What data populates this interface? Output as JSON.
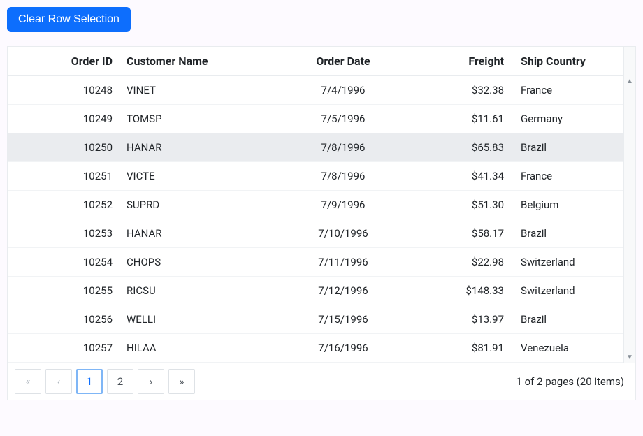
{
  "toolbar": {
    "clear_label": "Clear Row Selection"
  },
  "grid": {
    "columns": {
      "order_id": "Order ID",
      "customer_name": "Customer Name",
      "order_date": "Order Date",
      "freight": "Freight",
      "ship_country": "Ship Country"
    },
    "rows": [
      {
        "id": "10248",
        "name": "VINET",
        "date": "7/4/1996",
        "freight": "$32.38",
        "country": "France",
        "selected": false
      },
      {
        "id": "10249",
        "name": "TOMSP",
        "date": "7/5/1996",
        "freight": "$11.61",
        "country": "Germany",
        "selected": false
      },
      {
        "id": "10250",
        "name": "HANAR",
        "date": "7/8/1996",
        "freight": "$65.83",
        "country": "Brazil",
        "selected": true
      },
      {
        "id": "10251",
        "name": "VICTE",
        "date": "7/8/1996",
        "freight": "$41.34",
        "country": "France",
        "selected": false
      },
      {
        "id": "10252",
        "name": "SUPRD",
        "date": "7/9/1996",
        "freight": "$51.30",
        "country": "Belgium",
        "selected": false
      },
      {
        "id": "10253",
        "name": "HANAR",
        "date": "7/10/1996",
        "freight": "$58.17",
        "country": "Brazil",
        "selected": false
      },
      {
        "id": "10254",
        "name": "CHOPS",
        "date": "7/11/1996",
        "freight": "$22.98",
        "country": "Switzerland",
        "selected": false
      },
      {
        "id": "10255",
        "name": "RICSU",
        "date": "7/12/1996",
        "freight": "$148.33",
        "country": "Switzerland",
        "selected": false
      },
      {
        "id": "10256",
        "name": "WELLI",
        "date": "7/15/1996",
        "freight": "$13.97",
        "country": "Brazil",
        "selected": false
      },
      {
        "id": "10257",
        "name": "HILAA",
        "date": "7/16/1996",
        "freight": "$81.91",
        "country": "Venezuela",
        "selected": false
      }
    ]
  },
  "pager": {
    "first": "«",
    "prev": "‹",
    "pages": [
      "1",
      "2"
    ],
    "active_page": "1",
    "next": "›",
    "last": "»",
    "info": "1 of 2 pages (20 items)"
  }
}
